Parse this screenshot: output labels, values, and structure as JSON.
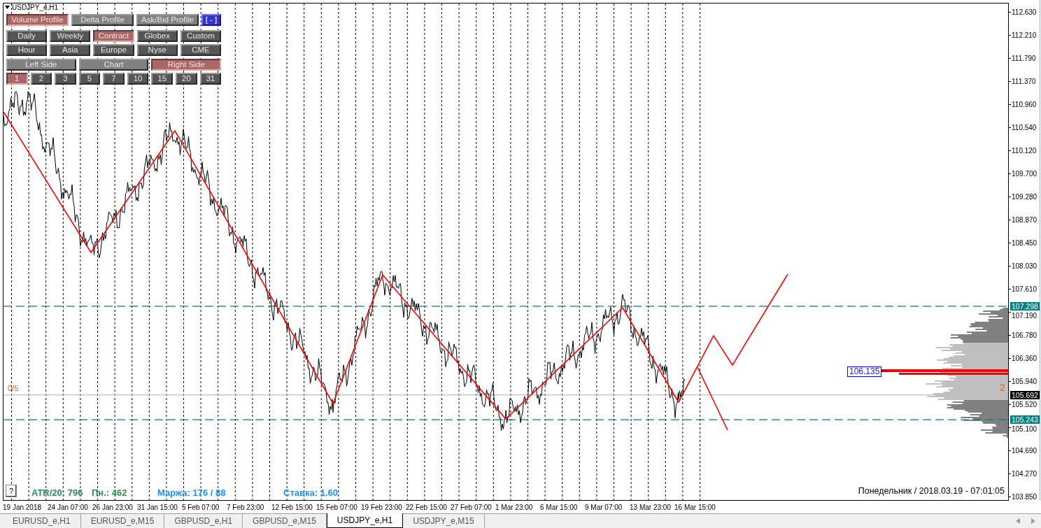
{
  "chart": {
    "symbol": "USDJPY_e,H1",
    "panel": [
      [
        {
          "label": "Volume Profile",
          "kind": "light",
          "selected": true
        },
        {
          "label": "Delta Profile",
          "kind": "light",
          "selected": false
        },
        {
          "label": "Ask/Bid Profile",
          "kind": "light",
          "selected": false
        },
        {
          "label": "[ - ]",
          "kind": "blue",
          "selected": false
        }
      ],
      [
        {
          "label": "Daily",
          "kind": "dark",
          "selected": false
        },
        {
          "label": "Weekly",
          "kind": "dark",
          "selected": false
        },
        {
          "label": "Contract",
          "kind": "dark",
          "selected": true
        },
        {
          "label": "Globex",
          "kind": "dark",
          "selected": false
        },
        {
          "label": "Custom",
          "kind": "dark",
          "selected": false
        }
      ],
      [
        {
          "label": "Hour",
          "kind": "dark",
          "selected": false
        },
        {
          "label": "Asia",
          "kind": "dark",
          "selected": false
        },
        {
          "label": "Europe",
          "kind": "dark",
          "selected": false
        },
        {
          "label": "Nyse",
          "kind": "dark",
          "selected": false
        },
        {
          "label": "CME",
          "kind": "dark",
          "selected": false
        }
      ],
      [
        {
          "label": "Left Side",
          "kind": "light",
          "selected": false
        },
        {
          "label": "Chart",
          "kind": "light",
          "selected": false
        },
        {
          "label": "Right Side",
          "kind": "light",
          "selected": true
        }
      ],
      [
        {
          "label": "1",
          "kind": "dark",
          "selected": true
        },
        {
          "label": "2",
          "kind": "dark",
          "selected": false
        },
        {
          "label": "3",
          "kind": "dark",
          "selected": false
        },
        {
          "label": "5",
          "kind": "dark",
          "selected": false
        },
        {
          "label": "7",
          "kind": "dark",
          "selected": false
        },
        {
          "label": "10",
          "kind": "dark",
          "selected": false
        },
        {
          "label": "15",
          "kind": "dark",
          "selected": false
        },
        {
          "label": "20",
          "kind": "dark",
          "selected": false
        },
        {
          "label": "31",
          "kind": "dark",
          "selected": false
        }
      ]
    ],
    "price_axis": [
      "112.630",
      "112.210",
      "111.790",
      "111.370",
      "110.960",
      "110.540",
      "110.120",
      "109.700",
      "109.280",
      "108.870",
      "108.450",
      "108.030",
      "107.610",
      "107.190",
      "106.780",
      "106.360",
      "105.940",
      "105.520",
      "105.100",
      "104.690",
      "104.270",
      "103.850"
    ],
    "price_markers": [
      {
        "value": "107.298",
        "kind": "level",
        "color": "#008080"
      },
      {
        "value": "105.692",
        "kind": "current",
        "color": "#000000"
      },
      {
        "value": "105.243",
        "kind": "level",
        "color": "#008080"
      }
    ],
    "poc_label": "106.135",
    "left_counter": "0/5",
    "right_counter": "2",
    "help_button": "?",
    "indicators": [
      {
        "text": "ATR/20: 796",
        "color": "#2e8b57"
      },
      {
        "text": "Пн.: 462",
        "color": "#2e8b57"
      },
      {
        "text": "Маржа: 176 / 88",
        "color": "#1e90ff"
      },
      {
        "text": "Ставка: 1.60",
        "color": "#1e90ff"
      }
    ],
    "clock": "Понедельник / 2018.03.19 - 07:01:05"
  },
  "time_axis": [
    "19 Jan 2018",
    "24 Jan 07:00",
    "26 Jan 23:00",
    "31 Jan 15:00",
    "5 Feb 07:00",
    "7 Feb 23:00",
    "12 Feb 15:00",
    "15 Feb 07:00",
    "19 Feb 23:00",
    "22 Feb 15:00",
    "27 Feb 07:00",
    "1 Mar 23:00",
    "6 Mar 15:00",
    "9 Mar 07:00",
    "13 Mar 23:00",
    "16 Mar 15:00"
  ],
  "tabs": [
    {
      "label": "EURUSD_e,H1",
      "selected": false
    },
    {
      "label": "EURUSD_e,M15",
      "selected": false
    },
    {
      "label": "GBPUSD_e,H1",
      "selected": false
    },
    {
      "label": "GBPUSD_e,M15",
      "selected": false
    },
    {
      "label": "USDJPY_e,H1",
      "selected": true
    },
    {
      "label": "USDJPY_e,M15",
      "selected": false
    }
  ]
}
